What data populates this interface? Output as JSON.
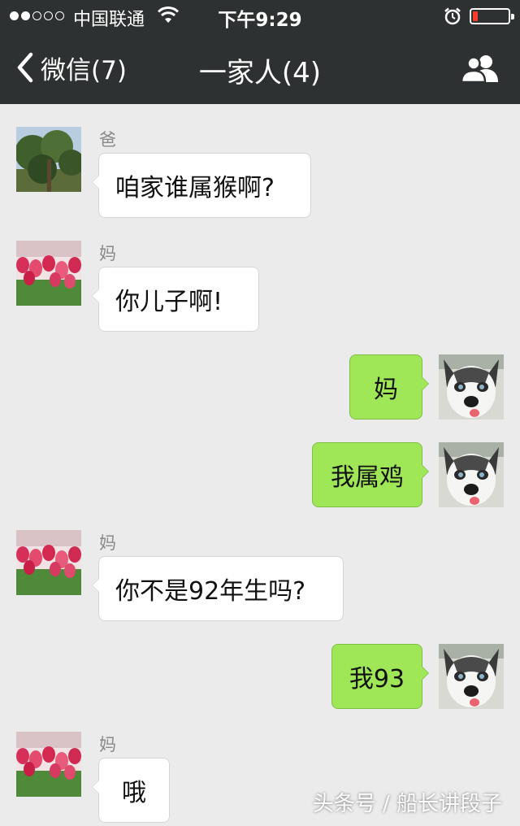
{
  "status_bar": {
    "carrier": "中国联通",
    "time": "下午9:29",
    "signal_strength": 2,
    "battery_level": 0.15,
    "battery_color": "#ff3b30",
    "icons": [
      "wifi-icon",
      "alarm-icon",
      "battery-icon"
    ]
  },
  "nav": {
    "back_label": "微信(7)",
    "title": "一家人(4)",
    "group_icon": "group-members-icon"
  },
  "messages": [
    {
      "side": "left",
      "sender": "爸",
      "text": "咱家谁属猴啊?",
      "avatar": "tree-photo-avatar"
    },
    {
      "side": "left",
      "sender": "妈",
      "text": "你儿子啊!",
      "avatar": "tulip-photo-avatar"
    },
    {
      "side": "right",
      "sender": "",
      "text": "妈",
      "avatar": "husky-photo-avatar"
    },
    {
      "side": "right",
      "sender": "",
      "text": "我属鸡",
      "avatar": "husky-photo-avatar"
    },
    {
      "side": "left",
      "sender": "妈",
      "text": "你不是92年生吗?",
      "avatar": "tulip-photo-avatar"
    },
    {
      "side": "right",
      "sender": "",
      "text": "我93",
      "avatar": "husky-photo-avatar"
    },
    {
      "side": "left",
      "sender": "妈",
      "text": "哦",
      "avatar": "tulip-photo-avatar"
    }
  ],
  "colors": {
    "nav_background": "#2e3132",
    "chat_background": "#ebebeb",
    "own_bubble": "#9fe757",
    "other_bubble": "#ffffff"
  },
  "watermark": "头条号 / 船长讲段子"
}
